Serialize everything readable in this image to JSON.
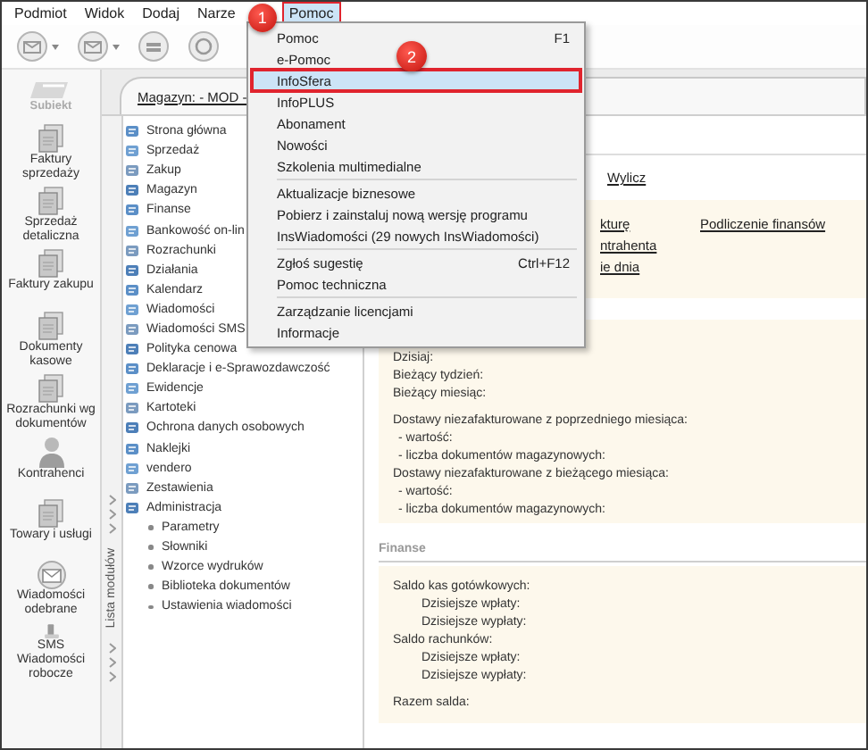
{
  "menu_bar": [
    {
      "label": "Podmiot",
      "selected": false
    },
    {
      "label": "Widok",
      "selected": false
    },
    {
      "label": "Dodaj",
      "selected": false
    },
    {
      "label": "Narze",
      "selected": false
    },
    {
      "label": "Pomoc",
      "selected": true
    }
  ],
  "callouts": [
    {
      "label": "1"
    },
    {
      "label": "2"
    }
  ],
  "sidebar": {
    "logo": "Subiekt",
    "items": [
      {
        "label": "Faktury sprzedaży"
      },
      {
        "label": "Sprzedaż detaliczna"
      },
      {
        "label": "Faktury zakupu"
      },
      {
        "label": "Dokumenty kasowe"
      },
      {
        "label": "Rozrachunki wg dokumentów"
      },
      {
        "label": "Kontrahenci"
      },
      {
        "label": "Towary i usługi"
      },
      {
        "label": "Wiadomości odebrane"
      },
      {
        "label": "SMS Wiadomości robocze"
      }
    ]
  },
  "tab": {
    "label": "Magazyn: - MOD -"
  },
  "module_strip": {
    "label": "Lista modułów"
  },
  "tree": [
    {
      "label": "Strona główna"
    },
    {
      "label": "Sprzedaż"
    },
    {
      "label": "Zakup"
    },
    {
      "label": "Magazyn"
    },
    {
      "label": "Finanse"
    },
    {
      "label": "Bankowość on-lin"
    },
    {
      "label": "Rozrachunki"
    },
    {
      "label": "Działania"
    },
    {
      "label": "Kalendarz"
    },
    {
      "label": "Wiadomości"
    },
    {
      "label": "Wiadomości SMS"
    },
    {
      "label": "Polityka cenowa"
    },
    {
      "label": "Deklaracje i e-Sprawozdawczość"
    },
    {
      "label": "Ewidencje"
    },
    {
      "label": "Kartoteki"
    },
    {
      "label": "Ochrona danych osobowych"
    },
    {
      "label": "Naklejki"
    },
    {
      "label": "vendero"
    },
    {
      "label": "Zestawienia"
    },
    {
      "label": "Administracja",
      "children": [
        {
          "label": "Parametry"
        },
        {
          "label": "Słowniki"
        },
        {
          "label": "Wzorce wydruków"
        },
        {
          "label": "Biblioteka dokumentów"
        },
        {
          "label": "Ustawienia wiadomości"
        }
      ]
    }
  ],
  "content": {
    "action_link": "Wylicz",
    "links": {
      "column_1": [
        "kturę",
        "ntrahenta",
        "ie dnia"
      ],
      "column_2": [
        "Podliczenie finansów"
      ]
    },
    "summary": [
      [
        {
          "label": "Dzisiaj:"
        },
        {
          "label": "Bieżący tydzień:"
        },
        {
          "label": "Bieżący miesiąc:"
        }
      ],
      [
        {
          "label": "Dostawy niezafakturowane z poprzedniego miesiąca:",
          "children": [
            "- wartość:",
            "- liczba dokumentów magazynowych:"
          ]
        },
        {
          "label": "Dostawy niezafakturowane z bieżącego miesiąca:",
          "children": [
            "- wartość:",
            "- liczba dokumentów magazynowych:"
          ]
        }
      ]
    ],
    "finance": {
      "title": "Finanse",
      "groups": [
        [
          {
            "label": "Saldo kas gotówkowych:",
            "children": [
              "Dzisiejsze wpłaty:",
              "Dzisiejsze wypłaty:"
            ]
          },
          {
            "label": "Saldo rachunków:",
            "children": [
              "Dzisiejsze wpłaty:",
              "Dzisiejsze wypłaty:"
            ]
          }
        ],
        [
          {
            "label": "Razem salda:"
          }
        ]
      ]
    }
  },
  "dropdown": {
    "groups": [
      [
        {
          "label": "Pomoc",
          "shortcut": "F1",
          "selected": false
        },
        {
          "label": "e-Pomoc",
          "selected": false
        },
        {
          "label": "InfoSfera",
          "selected": true
        },
        {
          "label": "InfoPLUS",
          "selected": false
        },
        {
          "label": "Abonament",
          "selected": false
        },
        {
          "label": "Nowości",
          "selected": false
        },
        {
          "label": "Szkolenia multimedialne",
          "selected": false
        }
      ],
      [
        {
          "label": "Aktualizacje biznesowe",
          "selected": false
        },
        {
          "label": "Pobierz i zainstaluj nową wersję programu",
          "selected": false
        },
        {
          "label": "InsWiadomości (29 nowych InsWiadomości)",
          "selected": false
        }
      ],
      [
        {
          "label": "Zgłoś sugestię",
          "shortcut": "Ctrl+F12",
          "selected": false
        },
        {
          "label": "Pomoc techniczna",
          "selected": false
        }
      ],
      [
        {
          "label": "Zarządzanie licencjami",
          "selected": false
        },
        {
          "label": "Informacje",
          "selected": false
        }
      ]
    ]
  }
}
